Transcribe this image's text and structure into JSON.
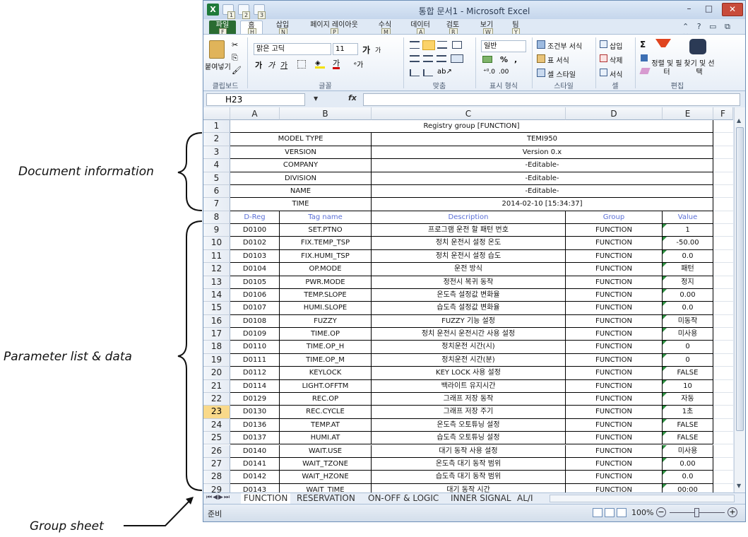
{
  "window": {
    "title": "통합 문서1 - Microsoft Excel",
    "app_icon": "excel-icon",
    "qat_badges": [
      "1",
      "2",
      "3"
    ],
    "controls": {
      "minimize": "–",
      "maximize": "□",
      "close": "✕"
    }
  },
  "ribbon": {
    "tabs": [
      {
        "label": "파일",
        "key": "F"
      },
      {
        "label": "홈",
        "key": "H"
      },
      {
        "label": "삽입",
        "key": "N"
      },
      {
        "label": "페이지 레이아웃",
        "key": "P"
      },
      {
        "label": "수식",
        "key": "M"
      },
      {
        "label": "데이터",
        "key": "A"
      },
      {
        "label": "검토",
        "key": "R"
      },
      {
        "label": "보기",
        "key": "W"
      },
      {
        "label": "팀",
        "key": "Y"
      }
    ],
    "paste_label": "붙여넣기",
    "font_name": "맑은 고딕",
    "font_size": "11",
    "grow_font": "가",
    "shrink_font": "가",
    "bold": "가",
    "italic": "가",
    "underline": "가",
    "font_color": "가",
    "number_format": "일반",
    "percent": "%",
    "comma": ",",
    "conditional_format": "조건부 서식",
    "table_format": "표 서식",
    "cell_style": "셀 스타일",
    "insert": "삽입",
    "delete": "삭제",
    "format": "서식",
    "sort_filter": "정렬 및 필터",
    "find_select": "찾기 및 선택",
    "sigma": "Σ",
    "group_labels": {
      "clipboard": "클립보드",
      "font": "글꼴",
      "alignment": "맞춤",
      "number": "표시 형식",
      "styles": "스타일",
      "cells": "셀",
      "editing": "편집"
    }
  },
  "formula_bar": {
    "name_box": "H23",
    "fx": "fx",
    "value": ""
  },
  "columns": [
    "A",
    "B",
    "C",
    "D",
    "E",
    "F"
  ],
  "sheet": {
    "title": "Registry group [FUNCTION]",
    "info": [
      {
        "label": "MODEL TYPE",
        "value": "TEMI950"
      },
      {
        "label": "VERSION",
        "value": "Version 0.x"
      },
      {
        "label": "COMPANY",
        "value": "-Editable-"
      },
      {
        "label": "DIVISION",
        "value": "-Editable-"
      },
      {
        "label": "NAME",
        "value": "-Editable-"
      },
      {
        "label": "TIME",
        "value": "2014-02-10 [15:34:37]"
      }
    ],
    "headers": [
      "D-Reg",
      "Tag name",
      "Description",
      "Group",
      "Value"
    ],
    "rows": [
      [
        "D0100",
        "SET.PTNO",
        "프로그램 운전 할 패턴 번호",
        "FUNCTION",
        "1"
      ],
      [
        "D0102",
        "FIX.TEMP_TSP",
        "정치 운전시 설정 온도",
        "FUNCTION",
        "-50.00"
      ],
      [
        "D0103",
        "FIX.HUMI_TSP",
        "정치 운전시 설정 습도",
        "FUNCTION",
        "0.0"
      ],
      [
        "D0104",
        "OP.MODE",
        "운전 방식",
        "FUNCTION",
        "패턴"
      ],
      [
        "D0105",
        "PWR.MODE",
        "정전시 복귀 동작",
        "FUNCTION",
        "정지"
      ],
      [
        "D0106",
        "TEMP.SLOPE",
        "온도측 설정값 변화율",
        "FUNCTION",
        "0.00"
      ],
      [
        "D0107",
        "HUMI.SLOPE",
        "습도측 설정값 변화율",
        "FUNCTION",
        "0.0"
      ],
      [
        "D0108",
        "FUZZY",
        "FUZZY 기능 설정",
        "FUNCTION",
        "미동작"
      ],
      [
        "D0109",
        "TIME.OP",
        "정치 운전시 운전시간 사용 설정",
        "FUNCTION",
        "미사용"
      ],
      [
        "D0110",
        "TIME.OP_H",
        "정치운전 시간(시)",
        "FUNCTION",
        "0"
      ],
      [
        "D0111",
        "TIME.OP_M",
        "정치운전 시간(분)",
        "FUNCTION",
        "0"
      ],
      [
        "D0112",
        "KEYLOCK",
        "KEY LOCK 사용 설정",
        "FUNCTION",
        "FALSE"
      ],
      [
        "D0114",
        "LIGHT.OFFTM",
        "백라이트 유지시간",
        "FUNCTION",
        "10"
      ],
      [
        "D0129",
        "REC.OP",
        "그래프 저장 동작",
        "FUNCTION",
        "자동"
      ],
      [
        "D0130",
        "REC.CYCLE",
        "그래프 저장 주기",
        "FUNCTION",
        "1초"
      ],
      [
        "D0136",
        "TEMP.AT",
        "온도측 오토튜닝 설정",
        "FUNCTION",
        "FALSE"
      ],
      [
        "D0137",
        "HUMI.AT",
        "습도측 오토튜닝 설정",
        "FUNCTION",
        "FALSE"
      ],
      [
        "D0140",
        "WAIT.USE",
        "대기 동작 사용 설정",
        "FUNCTION",
        "미사용"
      ],
      [
        "D0141",
        "WAIT_TZONE",
        "온도측 대기 동작 범위",
        "FUNCTION",
        "0.00"
      ],
      [
        "D0142",
        "WAIT_HZONE",
        "습도측 대기 동작 범위",
        "FUNCTION",
        "0.0"
      ],
      [
        "D0143",
        "WAIT_TIME",
        "대기 동작 시간",
        "FUNCTION",
        "00:00"
      ]
    ],
    "selected_row": 23
  },
  "sheet_tabs": [
    "FUNCTION",
    "RESERVATION",
    "ON-OFF & LOGIC",
    "INNER SIGNAL",
    "AL/I"
  ],
  "status": {
    "ready": "준비",
    "zoom": "100%"
  },
  "callouts": {
    "document_info": "Document information",
    "parameter_list": "Parameter list & data",
    "group_sheet": "Group sheet"
  },
  "colors": {
    "excel_green": "#1f7a3a",
    "header_text": "#5a6fd6",
    "selected_row": "#f9d98a",
    "close_button": "#c84b3b"
  }
}
